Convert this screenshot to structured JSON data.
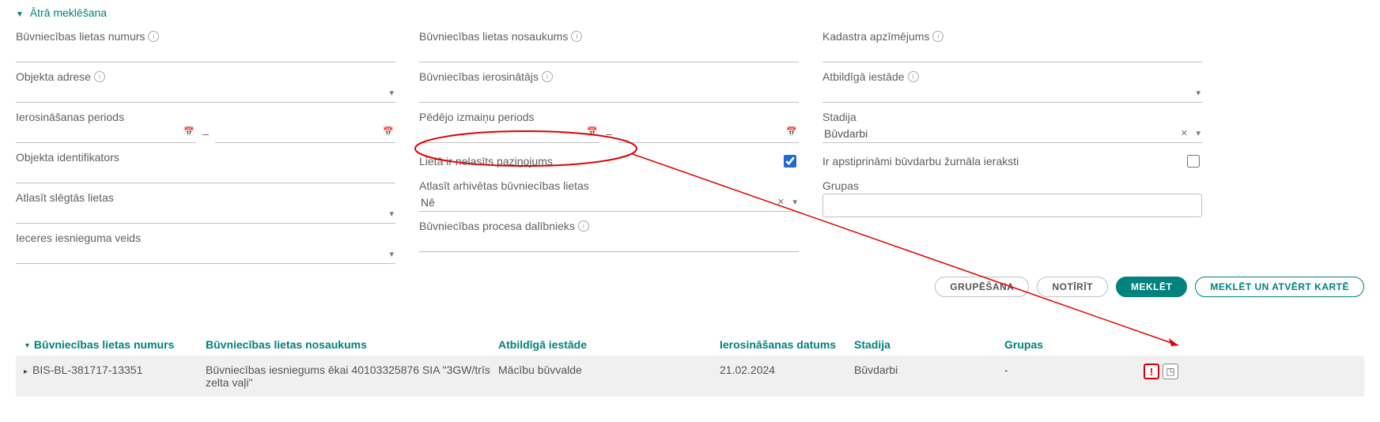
{
  "quick_search_title": "Ātrā meklēšana",
  "filters": {
    "col1": {
      "case_number": "Būvniecības lietas numurs",
      "object_address": "Objekta adrese",
      "init_period": "Ierosināšanas periods",
      "object_id": "Objekta identifikators",
      "select_closed": "Atlasīt slēgtās lietas",
      "intent_type": "Ieceres iesnieguma veids"
    },
    "col2": {
      "case_name": "Būvniecības lietas nosaukums",
      "initiator": "Būvniecības ierosinātājs",
      "change_period": "Pēdējo izmaiņu periods",
      "unread": "Lietā ir nelasīts paziņojums",
      "archived": "Atlasīt arhivētas būvniecības lietas",
      "archived_value": "Nē",
      "participant": "Būvniecības procesa dalībnieks"
    },
    "col3": {
      "kadastra": "Kadastra apzīmējums",
      "auth": "Atbildīgā iestāde",
      "stage_label": "Stadija",
      "stage_value": "Būvdarbi",
      "approvable": "Ir apstiprināmi būvdarbu žurnāla ieraksti",
      "groups_label": "Grupas"
    }
  },
  "buttons": {
    "group": "Grupēšana",
    "clear": "Notīrīt",
    "search": "Meklēt",
    "search_map": "Meklēt un atvērt kartē"
  },
  "table": {
    "headers": {
      "number": "Būvniecības lietas numurs",
      "name": "Būvniecības lietas nosaukums",
      "auth": "Atbildīgā iestāde",
      "date": "Ierosināšanas datums",
      "stage": "Stadija",
      "groups": "Grupas"
    },
    "rows": [
      {
        "number": "BIS-BL-381717-13351",
        "name": "Būvniecības iesniegums ēkai 40103325876 SIA \"3GW/trīs zelta vaļi\"",
        "auth": "Mācību būvvalde",
        "date": "21.02.2024",
        "stage": "Būvdarbi",
        "groups": "-"
      }
    ]
  }
}
